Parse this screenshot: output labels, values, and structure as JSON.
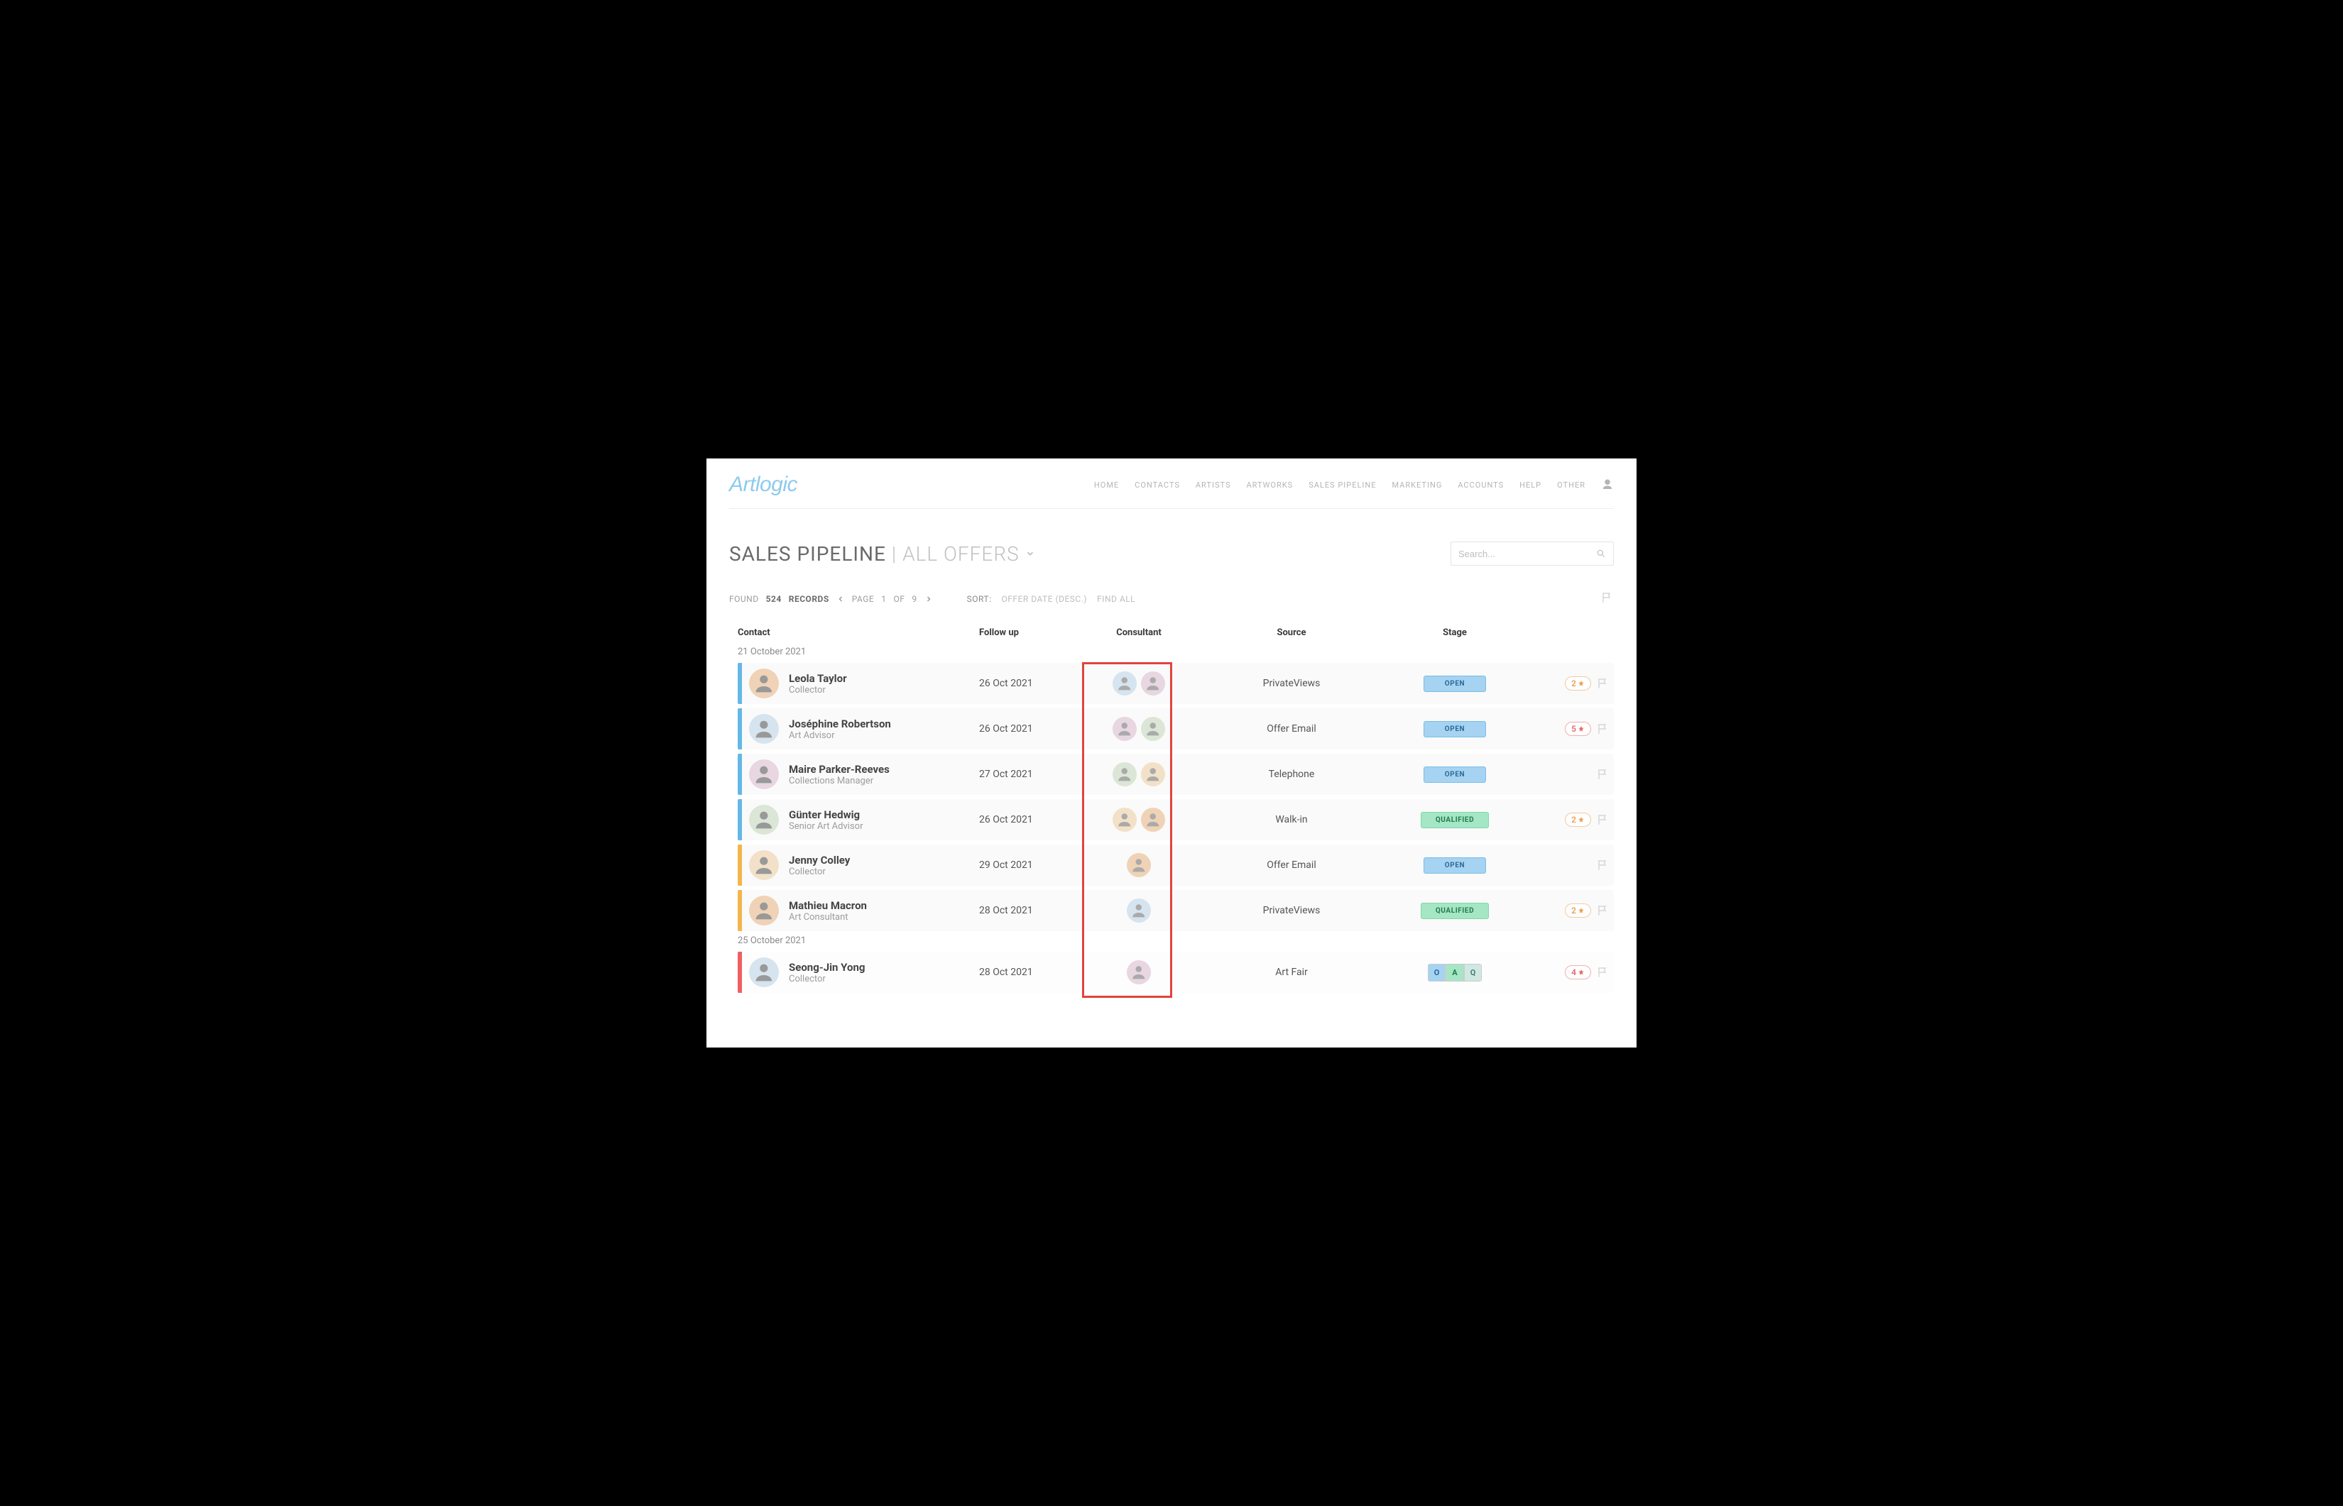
{
  "brand": "Artlogic",
  "nav": {
    "items": [
      "HOME",
      "CONTACTS",
      "ARTISTS",
      "ARTWORKS",
      "SALES PIPELINE",
      "MARKETING",
      "ACCOUNTS",
      "HELP",
      "OTHER"
    ]
  },
  "page": {
    "title": "SALES PIPELINE",
    "subtitle_sep": "|",
    "subtitle": "ALL OFFERS"
  },
  "search": {
    "placeholder": "Search..."
  },
  "meta": {
    "found_label": "FOUND",
    "records_count": "524",
    "records_label": "RECORDS",
    "page_label": "PAGE",
    "page_current": "1",
    "page_of": "OF",
    "page_total": "9",
    "sort_label": "SORT:",
    "sort_value": "OFFER DATE (DESC.)",
    "find_all": "FIND ALL"
  },
  "columns": {
    "contact": "Contact",
    "followup": "Follow up",
    "consultant": "Consultant",
    "source": "Source",
    "stage": "Stage"
  },
  "groups": [
    {
      "date": "21 October 2021",
      "rows": [
        {
          "bar_color": "blue",
          "name": "Leola Taylor",
          "role": "Collector",
          "followup": "26 Oct 2021",
          "consultant_count": 2,
          "source": "PrivateViews",
          "stage": "OPEN",
          "stage_type": "open",
          "star": "2",
          "star_color": "orange"
        },
        {
          "bar_color": "blue",
          "name": "Joséphine Robertson",
          "role": "Art Advisor",
          "followup": "26 Oct 2021",
          "consultant_count": 2,
          "source": "Offer Email",
          "stage": "OPEN",
          "stage_type": "open",
          "star": "5",
          "star_color": "red"
        },
        {
          "bar_color": "blue",
          "name": "Maire Parker-Reeves",
          "role": "Collections Manager",
          "followup": "27 Oct 2021",
          "consultant_count": 2,
          "source": "Telephone",
          "stage": "OPEN",
          "stage_type": "open",
          "star": "",
          "star_color": ""
        },
        {
          "bar_color": "blue",
          "name": "Günter Hedwig",
          "role": "Senior Art Advisor",
          "followup": "26 Oct 2021",
          "consultant_count": 2,
          "source": "Walk-in",
          "stage": "QUALIFIED",
          "stage_type": "qualified",
          "star": "2",
          "star_color": "orange"
        },
        {
          "bar_color": "orange",
          "name": "Jenny Colley",
          "role": "Collector",
          "followup": "29 Oct 2021",
          "consultant_count": 1,
          "source": "Offer Email",
          "stage": "OPEN",
          "stage_type": "open",
          "star": "",
          "star_color": ""
        },
        {
          "bar_color": "orange",
          "name": "Mathieu Macron",
          "role": "Art Consultant",
          "followup": "28 Oct 2021",
          "consultant_count": 1,
          "source": "PrivateViews",
          "stage": "QUALIFIED",
          "stage_type": "qualified",
          "star": "2",
          "star_color": "orange"
        }
      ]
    },
    {
      "date": "25 October 2021",
      "rows": [
        {
          "bar_color": "red",
          "name": "Seong-Jin Yong",
          "role": "Collector",
          "followup": "28 Oct 2021",
          "consultant_count": 1,
          "source": "Art Fair",
          "stage": "",
          "stage_type": "multi",
          "stage_multi": [
            "O",
            "A",
            "Q"
          ],
          "star": "4",
          "star_color": "red"
        }
      ]
    }
  ]
}
